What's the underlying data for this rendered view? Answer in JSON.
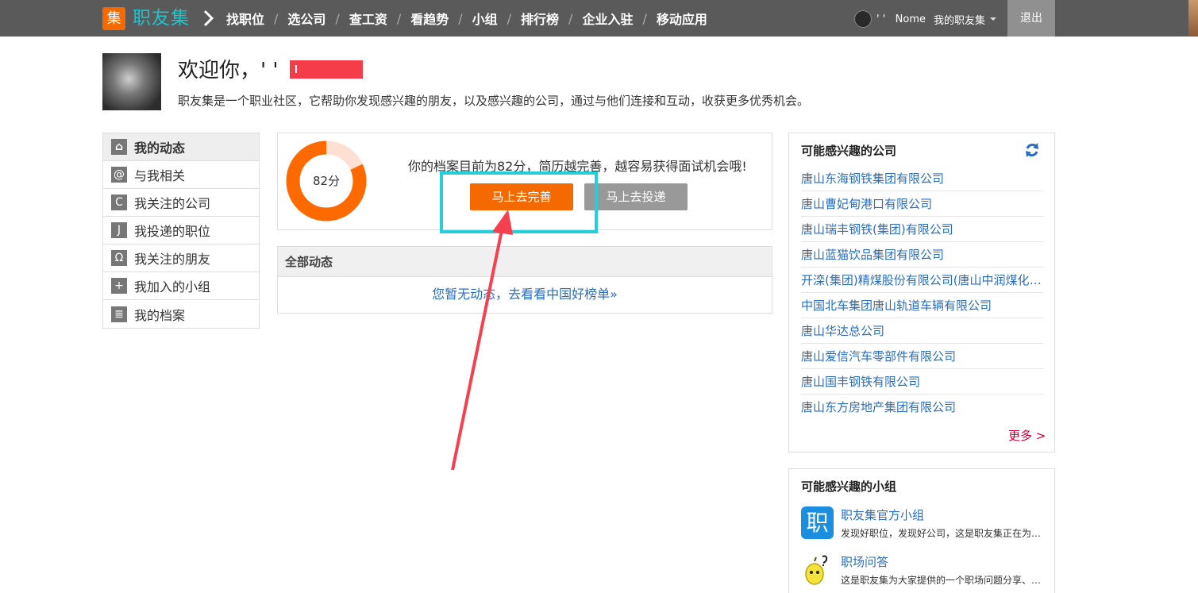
{
  "nav": {
    "logo_char": "集",
    "logo_text": "职友集",
    "items": [
      "找职位",
      "选公司",
      "查工资",
      "看趋势",
      "小组",
      "排行榜",
      "企业入驻",
      "移动应用"
    ],
    "separator": "/",
    "user_name": "' '   Nome",
    "my_link": "我的职友集",
    "logout": "退出"
  },
  "header": {
    "welcome": "欢迎你，' '",
    "intro": "职友集是一个职业社区，它帮助你发现感兴趣的朋友，以及感兴趣的公司，通过与他们连接和互动，收获更多优秀机会。"
  },
  "menu": {
    "items": [
      {
        "label": "我的动态",
        "icon": "home-icon",
        "glyph": "⌂",
        "active": true
      },
      {
        "label": "与我相关",
        "icon": "at-icon",
        "glyph": "@",
        "active": false
      },
      {
        "label": "我关注的公司",
        "icon": "company-icon",
        "glyph": "C",
        "active": false
      },
      {
        "label": "我投递的职位",
        "icon": "job-icon",
        "glyph": "J",
        "active": false
      },
      {
        "label": "我关注的朋友",
        "icon": "friend-icon",
        "glyph": "Ω",
        "active": false
      },
      {
        "label": "我加入的小组",
        "icon": "group-icon",
        "glyph": "+",
        "active": false
      },
      {
        "label": "我的档案",
        "icon": "profile-icon",
        "glyph": "≣",
        "active": false
      }
    ]
  },
  "profile_score": {
    "score": 82,
    "score_label": "82分",
    "message": "你的档案目前为82分，简历越完善，越容易获得面试机会哦!",
    "complete_button": "马上去完善",
    "deliver_button": "马上去投递",
    "colors": {
      "filled": "#ff6a00",
      "remaining": "#fde0d2"
    }
  },
  "activity": {
    "title": "全部动态",
    "empty_text": "您暂无动态，去看看中国好榜单»"
  },
  "companies": {
    "title": "可能感兴趣的公司",
    "items": [
      "唐山东海钢铁集团有限公司",
      "唐山曹妃甸港口有限公司",
      "唐山瑞丰钢铁(集团)有限公司",
      "唐山蓝猫饮品集团有限公司",
      "开滦(集团)精煤股份有限公司(唐山中润煤化工公司)",
      "中国北车集团唐山轨道车辆有限公司",
      "唐山华达总公司",
      "唐山爱信汽车零部件有限公司",
      "唐山国丰钢铁有限公司",
      "唐山东方房地产集团有限公司"
    ],
    "more": "更多 >"
  },
  "groups": {
    "title": "可能感兴趣的小组",
    "items": [
      {
        "name": "职友集官方小组",
        "desc": "发现好职位，发现好公司，这是职友集正在为你做的事情",
        "logo_char": "职"
      },
      {
        "name": "职场问答",
        "desc": "这是职友集为大家提供的一个职场问题分享、交流的平台",
        "logo_char": ""
      }
    ]
  },
  "colors": {
    "topbar": "#5a5a5a",
    "brand_orange": "#f56a00",
    "brand_teal": "#1fc3cc",
    "link_blue": "#2a6ebb",
    "annotation_cyan": "#24cfd9",
    "annotation_red": "#f5414f"
  }
}
